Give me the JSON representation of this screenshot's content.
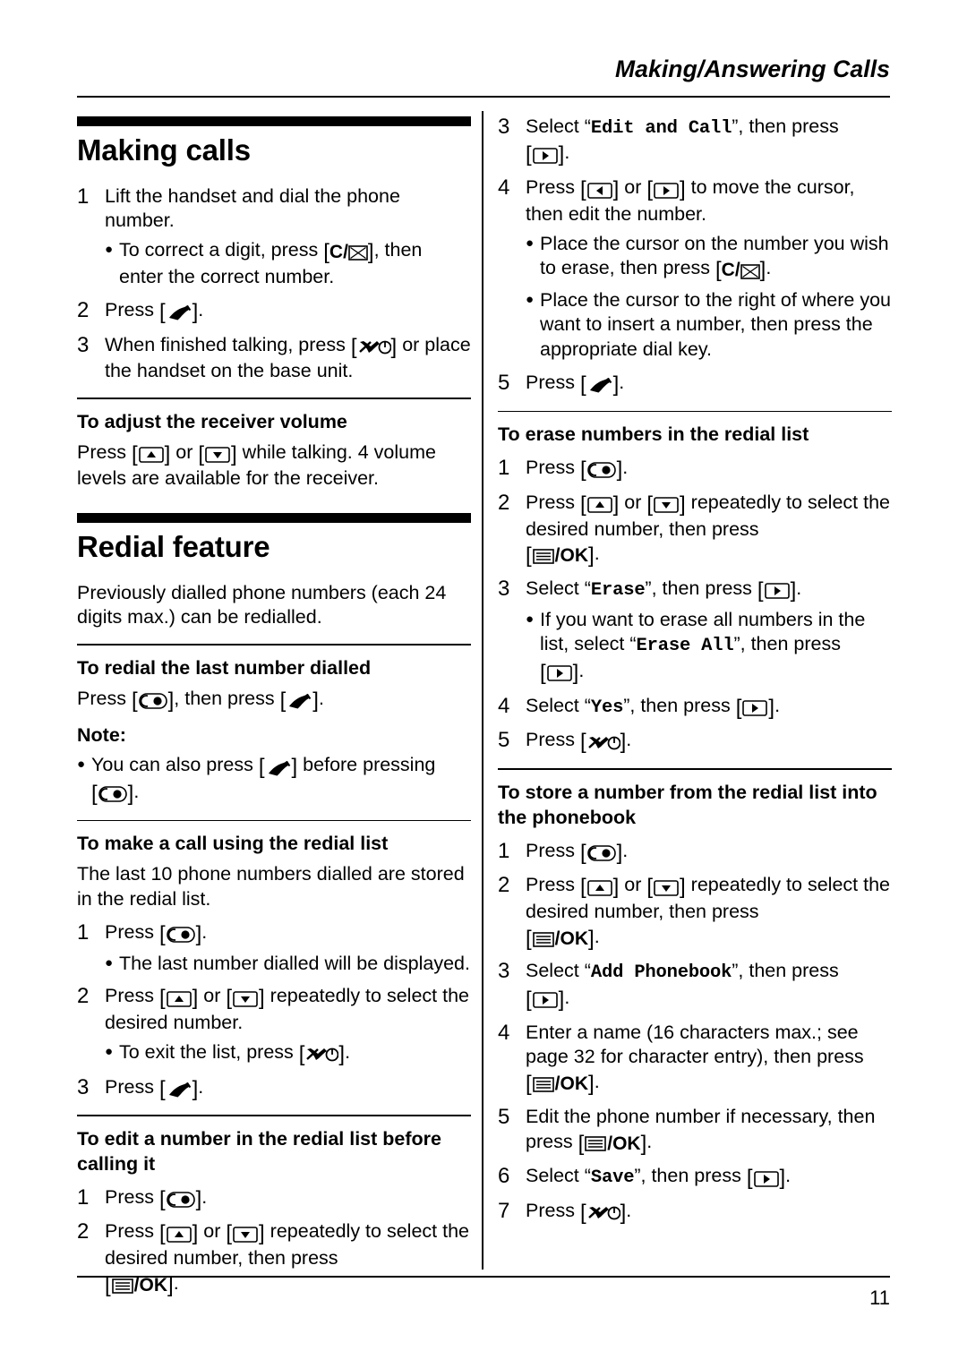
{
  "header": {
    "title": "Making/Answering Calls"
  },
  "footer": {
    "page_number": "11"
  },
  "left": {
    "section_title": "Making calls",
    "steps": [
      {
        "num": "1",
        "pre": "Lift the handset and dial the phone number."
      },
      {
        "num": "2",
        "pre": "Press ",
        "key": "talk",
        "post": "."
      },
      {
        "num": "3",
        "pre": "When finished talking, press ",
        "key": "off",
        "post": " or place the handset on the base unit."
      }
    ],
    "step1_bullet": {
      "pre": "To correct a digit, press ",
      "key": "clear",
      "post": ", then enter the correct number."
    },
    "volume": {
      "heading": "To adjust the receiver volume",
      "text_pre": "Press ",
      "key_up": "up",
      "text_mid": " or ",
      "key_down": "down",
      "text_post": " while talking. 4 volume levels are available for the receiver."
    },
    "redial_title": "Redial feature",
    "redial_intro": "Previously dialled phone numbers (each 24 digits max.) can be redialled.",
    "last_number": {
      "heading": "To redial the last number dialled",
      "pre": "Press ",
      "key1": "redial",
      "mid": ", then press ",
      "key2": "talk",
      "post": ".",
      "note_label": "Note:",
      "note_pre": "You can also press ",
      "note_key1": "talk",
      "note_mid": " before pressing ",
      "note_key2": "redial",
      "note_post": "."
    },
    "make_call": {
      "heading": "To make a call using the redial list",
      "intro": "The last 10 phone numbers dialled are stored in the redial list.",
      "steps": [
        {
          "num": "1",
          "pre": "Press ",
          "key": "redial",
          "post": "."
        },
        {
          "num": "2",
          "pre": "Press ",
          "key": "up",
          "mid": " or ",
          "key2": "down",
          "post": " repeatedly to select the desired number."
        },
        {
          "num": "3",
          "pre": "Press ",
          "key": "talk",
          "post": "."
        }
      ],
      "bullet1": "The last number dialled will be displayed.",
      "bullet2_pre": "To exit the list, press ",
      "bullet2_key": "off",
      "bullet2_post": "."
    },
    "edit_number": {
      "heading": "To edit a number in the redial list before calling it",
      "steps": [
        {
          "num": "1",
          "pre": "Press ",
          "key": "redial",
          "post": "."
        },
        {
          "num": "2",
          "pre": "Press ",
          "key": "up",
          "mid": " or ",
          "key2": "down",
          "post": " repeatedly to select the desired number, then press "
        }
      ],
      "ok_key": "/OK"
    }
  },
  "right": {
    "steps": [
      {
        "num": "3",
        "pre": "Select ",
        "quoted": "Edit and Call",
        "post": ", then press ",
        "key": "right",
        "end": "."
      },
      {
        "num": "4",
        "pre": "Press ",
        "key": "left",
        "mid": " or ",
        "key2": "right",
        "post": " to move the cursor, then edit the number."
      },
      {
        "num": "5",
        "pre": "Press ",
        "key": "talk",
        "post": "."
      }
    ],
    "step4_bullets": [
      {
        "pre": "Place the cursor on the number you wish to erase, then press ",
        "key": "clear",
        "post": "."
      },
      {
        "pre": "Place the cursor to the right of where you want to insert a number, then press the appropriate dial key.",
        "key": "",
        "post": ""
      }
    ],
    "erase": {
      "heading": "To erase numbers in the redial list",
      "steps": [
        {
          "num": "1",
          "pre": "Press ",
          "key": "redial",
          "post": "."
        },
        {
          "num": "2",
          "pre": "Press ",
          "key": "up",
          "mid": " or ",
          "key2": "down",
          "post": " repeatedly to select the desired number, then press "
        },
        {
          "num": "3",
          "pre": "Select ",
          "quoted": "Erase",
          "post": ", then press ",
          "key": "right",
          "end": "."
        },
        {
          "num": "4",
          "pre": "Select ",
          "quoted": "Yes",
          "post": ", then press ",
          "key": "right",
          "end": "."
        },
        {
          "num": "5",
          "pre": "Press ",
          "key": "off",
          "post": "."
        }
      ],
      "ok_key": "/OK",
      "bullet_pre": "If you want to erase all numbers in the list, select ",
      "bullet_quoted": "Erase All",
      "bullet_mid": ", then press ",
      "bullet_key": "right",
      "bullet_post": "."
    },
    "store": {
      "heading_line1": "To store a number from the redial list into",
      "heading_line2": "the phonebook",
      "steps": [
        {
          "num": "1",
          "pre": "Press ",
          "key": "redial",
          "post": "."
        },
        {
          "num": "2",
          "pre": "Press ",
          "key": "up",
          "mid": " or ",
          "key2": "down",
          "post": " repeatedly to select the desired number, then press "
        },
        {
          "num": "3",
          "pre": "Select ",
          "quoted": "Add Phonebook",
          "post": ", then press ",
          "key": "right",
          "end": "."
        },
        {
          "num": "4",
          "pre": "Enter a name (16 characters max.; see page 32 for character entry), then press "
        },
        {
          "num": "5",
          "pre": "Edit the phone number if necessary, then press "
        },
        {
          "num": "6",
          "pre": "Select ",
          "quoted": "Save",
          "post": ", then press ",
          "key": "right",
          "end": "."
        },
        {
          "num": "7",
          "pre": "Press ",
          "key": "off",
          "post": "."
        }
      ],
      "ok_key": "/OK"
    }
  },
  "icons": {
    "talk": "talk-handset-icon",
    "off": "power-off-icon",
    "redial": "redial-icon",
    "up": "navigator-up-icon",
    "down": "navigator-down-icon",
    "left": "navigator-left-icon",
    "right": "navigator-right-icon",
    "clear": "clear-key-icon",
    "ok": "menu-ok-key-icon"
  }
}
